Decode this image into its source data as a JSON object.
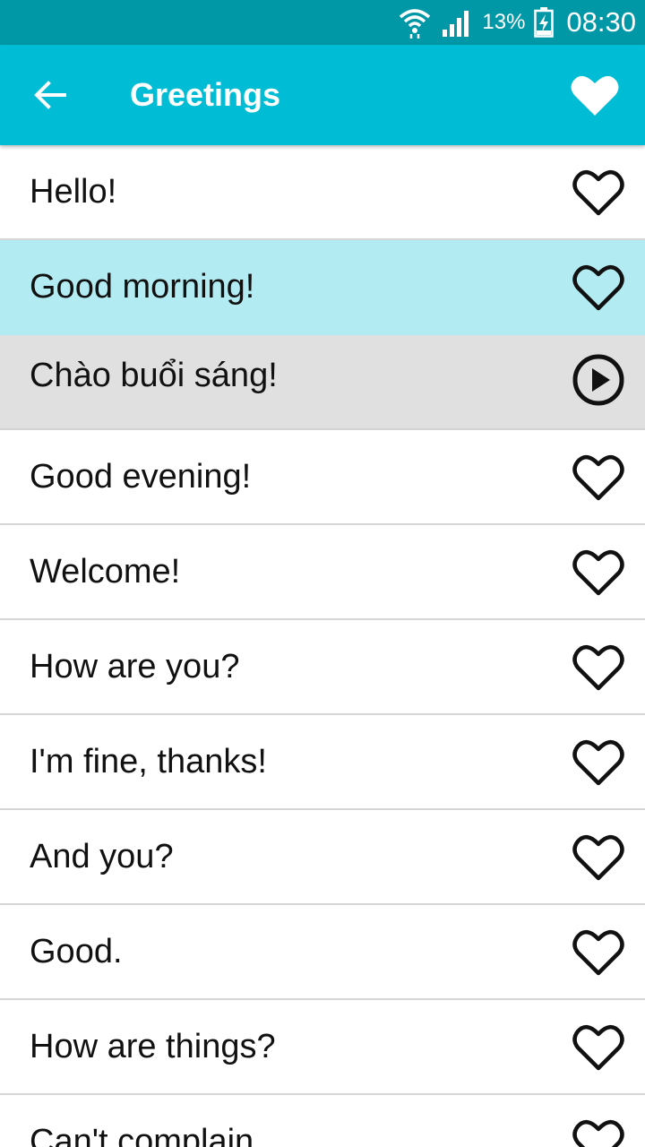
{
  "status_bar": {
    "battery_percent": "13%",
    "time": "08:30",
    "icons": [
      "wifi-icon",
      "signal-icon",
      "battery-charging-icon"
    ]
  },
  "app_bar": {
    "title": "Greetings",
    "back_icon": "arrow-left-icon",
    "favorite_icon": "heart-filled-icon"
  },
  "colors": {
    "status_bar": "#0097a7",
    "app_bar": "#00bcd4",
    "selected_row": "#b2ebf2",
    "translation_row": "#e0e0e0"
  },
  "phrases": [
    {
      "text": "Hello!",
      "state": "normal",
      "icon": "heart-outline-icon"
    },
    {
      "text": "Good morning!",
      "state": "selected",
      "icon": "heart-outline-icon"
    },
    {
      "text": "Chào buổi sáng!",
      "state": "translation",
      "icon": "play-circle-icon"
    },
    {
      "text": "Good evening!",
      "state": "normal",
      "icon": "heart-outline-icon"
    },
    {
      "text": "Welcome!",
      "state": "normal",
      "icon": "heart-outline-icon"
    },
    {
      "text": "How are you?",
      "state": "normal",
      "icon": "heart-outline-icon"
    },
    {
      "text": "I'm fine, thanks!",
      "state": "normal",
      "icon": "heart-outline-icon"
    },
    {
      "text": "And you?",
      "state": "normal",
      "icon": "heart-outline-icon"
    },
    {
      "text": "Good.",
      "state": "normal",
      "icon": "heart-outline-icon"
    },
    {
      "text": "How are things?",
      "state": "normal",
      "icon": "heart-outline-icon"
    },
    {
      "text": "Can't complain.",
      "state": "normal",
      "icon": "heart-outline-icon"
    }
  ]
}
